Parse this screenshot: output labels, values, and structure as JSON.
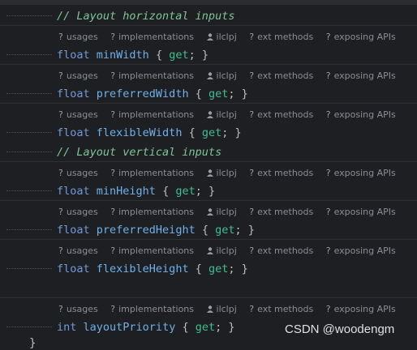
{
  "hints": {
    "usages": "usages",
    "implementations": "implementations",
    "author": "ilclpj",
    "ext_methods": "ext methods",
    "exposing_apis": "exposing APIs"
  },
  "code": {
    "comment_horizontal": "// Layout horizontal inputs",
    "comment_vertical": "// Layout vertical inputs",
    "kw_float": "float",
    "kw_int": "int",
    "kw_get": "get",
    "open_brace": "{",
    "close_brace": "}",
    "semicolon": ";",
    "min_width": "minWidth",
    "preferred_width": "preferredWidth",
    "flexible_width": "flexibleWidth",
    "min_height": "minHeight",
    "preferred_height": "preferredHeight",
    "flexible_height": "flexibleHeight",
    "layout_priority": "layoutPriority",
    "closing_brace": "}"
  },
  "watermark": "CSDN @woodengm",
  "icons": {
    "hint_prefix": "question-mark-icon",
    "author": "person-icon"
  },
  "colors": {
    "background": "#1e1f22",
    "comment": "#7ec699",
    "keyword": "#6f9ad8",
    "identifier": "#6fb0e8",
    "accessor": "#3fbf8f"
  }
}
